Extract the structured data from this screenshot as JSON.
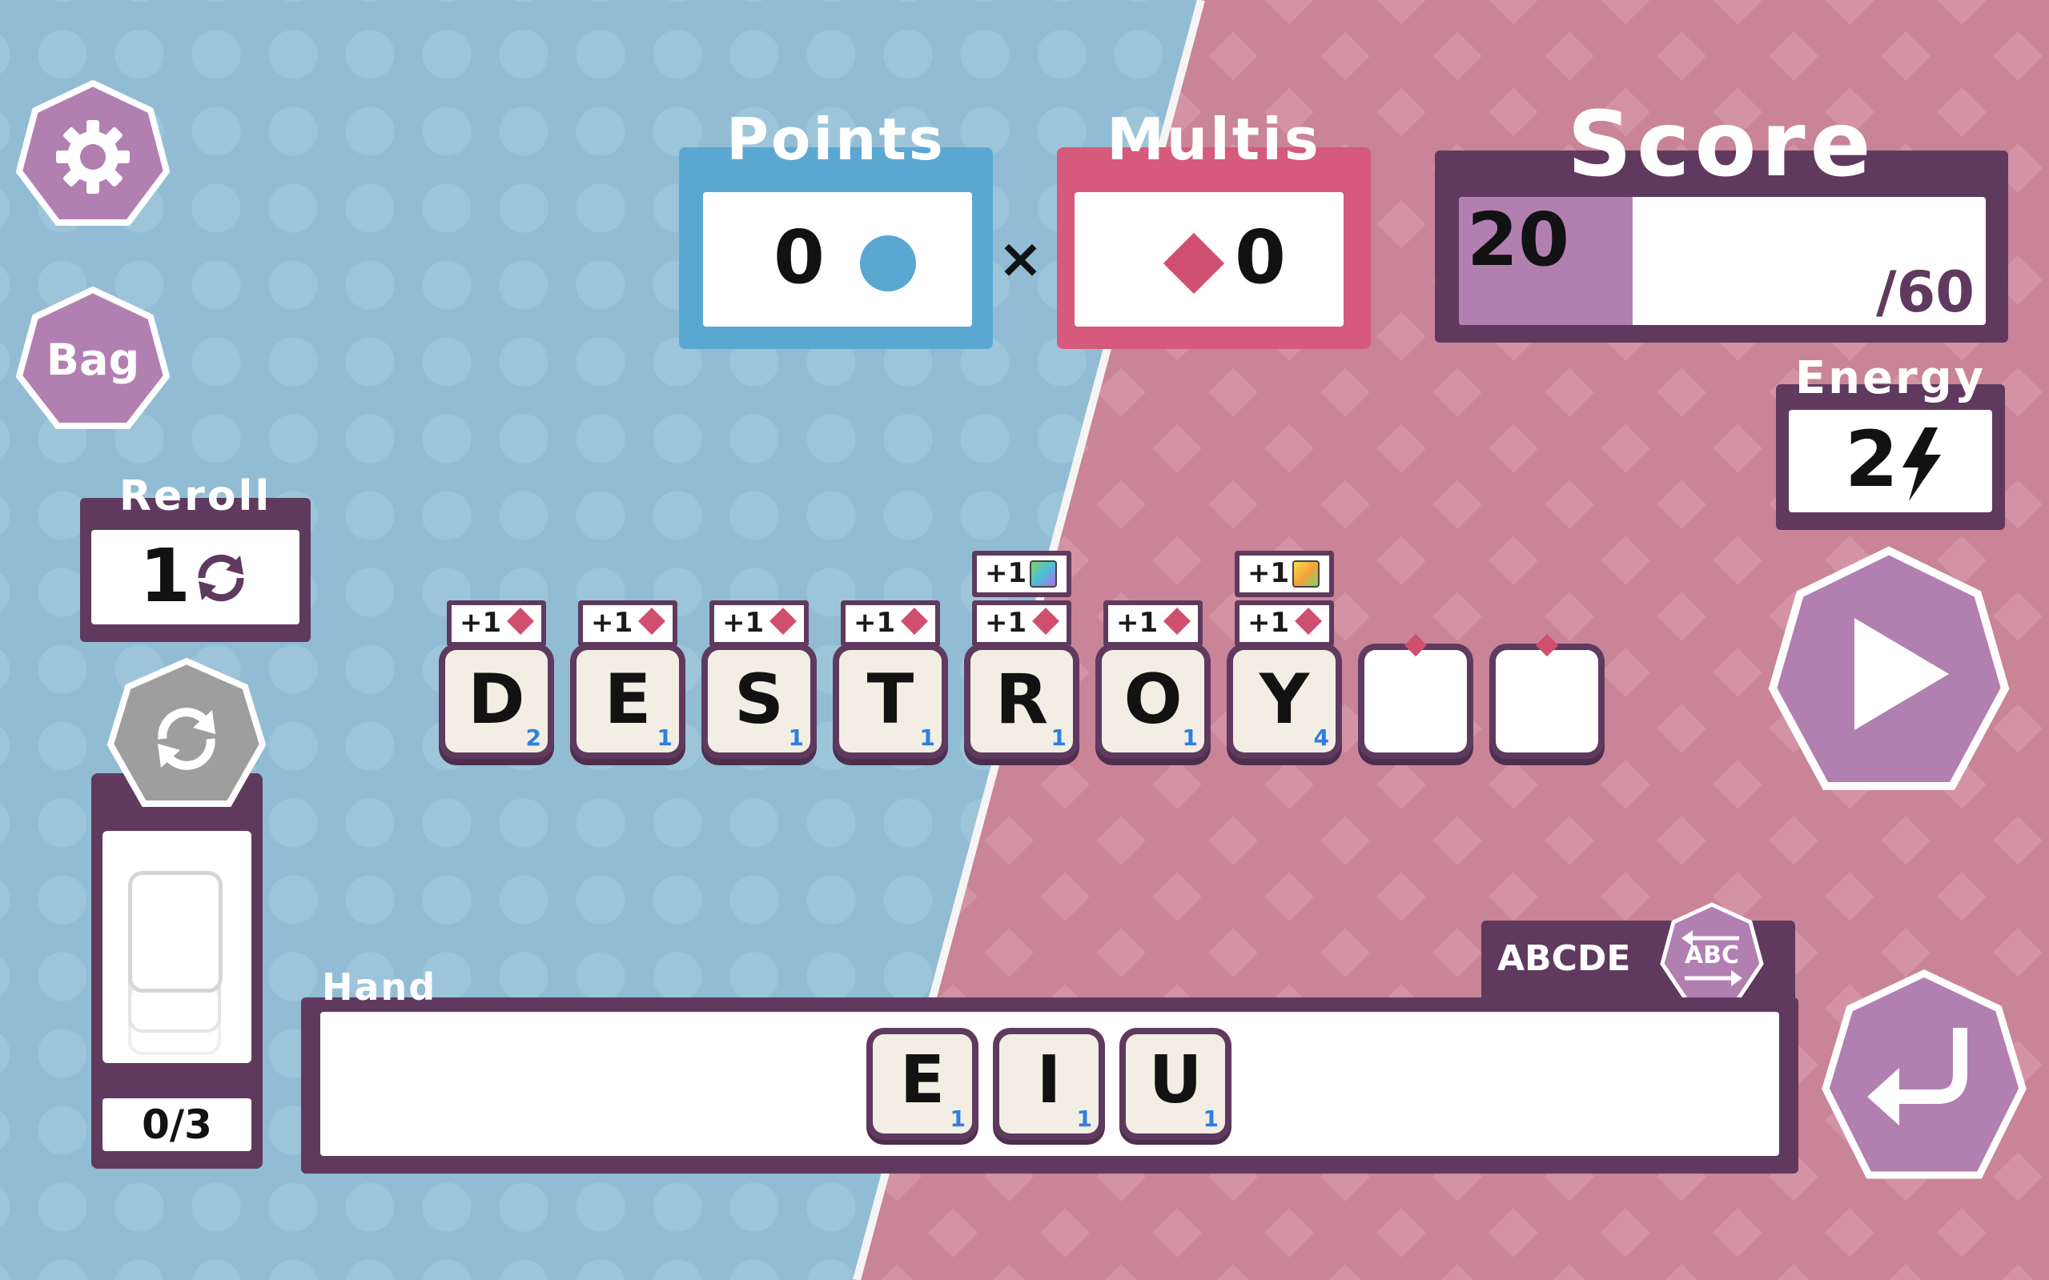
{
  "colors": {
    "accent_purple": "#b27fb1",
    "frame_purple": "#5f3a5e",
    "points_blue": "#5aa8d2",
    "multis_pink": "#d65a7b"
  },
  "buttons": {
    "settings_icon": "gear-icon",
    "bag_label": "Bag",
    "play_icon": "play-icon",
    "submit_icon": "return-icon",
    "cycle_icon": "cycle-icon",
    "sort_label": "ABC"
  },
  "points": {
    "label": "Points",
    "value": "0"
  },
  "times": "×",
  "multis": {
    "label": "Multis",
    "value": "0"
  },
  "score": {
    "label": "Score",
    "current": "20",
    "target": "/60",
    "progress_fraction": 0.33
  },
  "energy": {
    "label": "Energy",
    "value": "2"
  },
  "reroll": {
    "label": "Reroll",
    "value": "1"
  },
  "discard": {
    "counter": "0/3"
  },
  "word": {
    "tiles": [
      {
        "letter": "D",
        "value": "2",
        "bonus": [
          "+1"
        ]
      },
      {
        "letter": "E",
        "value": "1",
        "bonus": [
          "+1"
        ]
      },
      {
        "letter": "S",
        "value": "1",
        "bonus": [
          "+1"
        ]
      },
      {
        "letter": "T",
        "value": "1",
        "bonus": [
          "+1"
        ]
      },
      {
        "letter": "R",
        "value": "1",
        "bonus": [
          "+1",
          "+1"
        ]
      },
      {
        "letter": "O",
        "value": "1",
        "bonus": [
          "+1"
        ]
      },
      {
        "letter": "Y",
        "value": "4",
        "bonus": [
          "+1",
          "+1"
        ]
      }
    ]
  },
  "hand": {
    "label": "Hand",
    "sort_text": "ABCDE",
    "tiles": [
      {
        "letter": "E",
        "value": "1"
      },
      {
        "letter": "I",
        "value": "1"
      },
      {
        "letter": "U",
        "value": "1"
      }
    ]
  }
}
